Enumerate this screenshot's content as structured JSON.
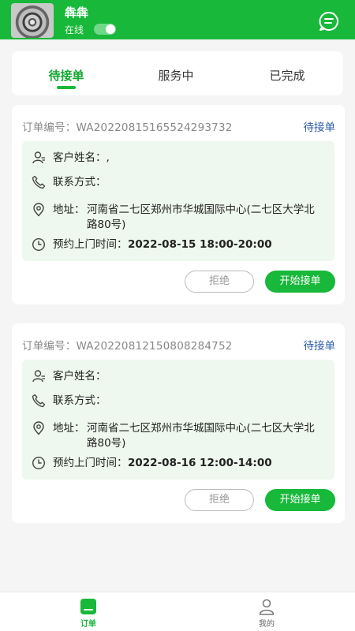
{
  "header": {
    "user_name": "犇犇",
    "status_label": "在线",
    "online": true
  },
  "tabs": [
    {
      "label": "待接单",
      "active": true
    },
    {
      "label": "服务中",
      "active": false
    },
    {
      "label": "已完成",
      "active": false
    }
  ],
  "orders": [
    {
      "order_no": "订单编号：WA20220815165524293732",
      "status": "待接单",
      "customer_label": "客户姓名：,",
      "contact_label": "联系方式：",
      "address_label": "地址：",
      "address": "河南省二七区郑州市华城国际中心(二七区大学北路80号)",
      "time_label": "预约上门时间：",
      "time": "2022-08-15 18:00-20:00",
      "reject_label": "拒绝",
      "accept_label": "开始接单"
    },
    {
      "order_no": "订单编号：WA20220812150808284752",
      "status": "待接单",
      "customer_label": "客户姓名：",
      "contact_label": "联系方式：",
      "address_label": "地址：",
      "address": "河南省二七区郑州市华城国际中心(二七区大学北路80号)",
      "time_label": "预约上门时间：",
      "time": "2022-08-16 12:00-14:00",
      "reject_label": "拒绝",
      "accept_label": "开始接单"
    }
  ],
  "tabbar": [
    {
      "label": "订单",
      "active": true,
      "icon": "order-icon"
    },
    {
      "label": "我的",
      "active": false,
      "icon": "user-icon"
    }
  ],
  "colors": {
    "brand": "#18b83a",
    "status_link": "#2d5ca8",
    "info_bg": "#eef8ee"
  }
}
